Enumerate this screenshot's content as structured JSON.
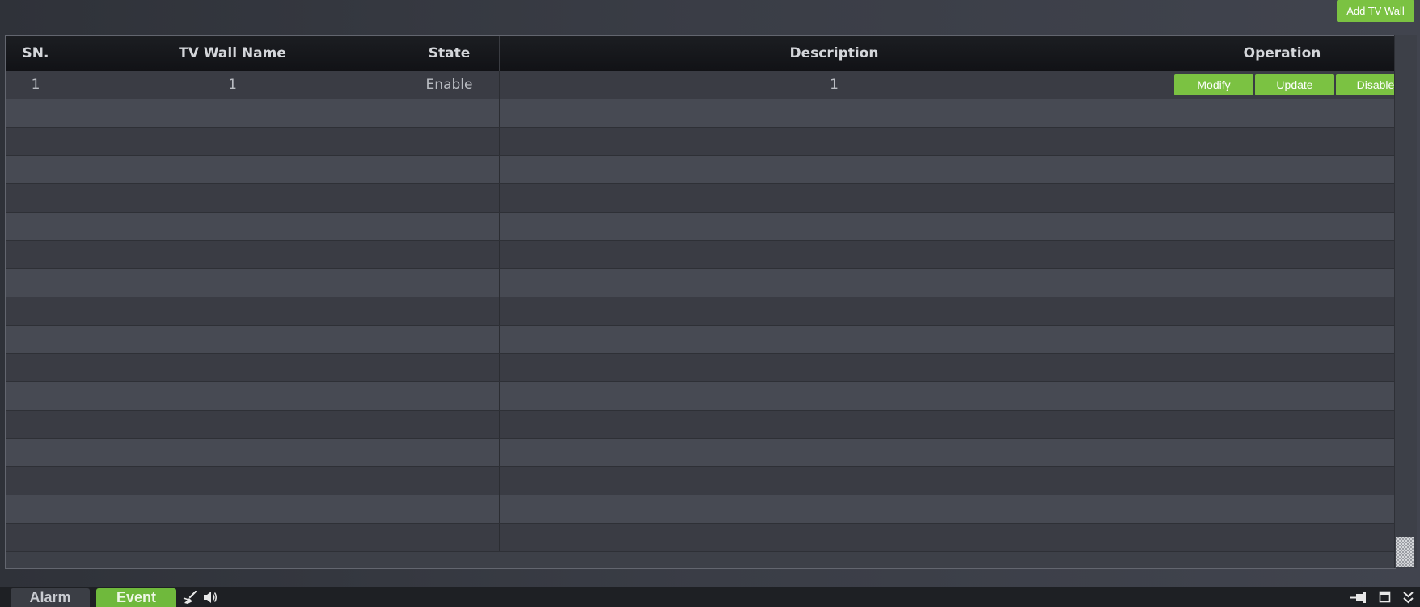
{
  "toolbar": {
    "add_label": "Add TV Wall"
  },
  "table": {
    "columns": [
      "SN.",
      "TV Wall Name",
      "State",
      "Description",
      "Operation"
    ],
    "rows": [
      {
        "sn": "1",
        "name": "1",
        "state": "Enable",
        "description": "1",
        "actions": [
          "Modify",
          "Update",
          "Disable"
        ]
      }
    ]
  },
  "bottom_bar": {
    "tabs": [
      "Alarm",
      "Event"
    ],
    "active_tab": "Event",
    "icons": [
      "broom-icon",
      "speaker-icon",
      "pin-icon",
      "maximize-icon",
      "collapse-icon"
    ]
  },
  "colors": {
    "accent": "#7bc242",
    "active_tab": "#6fb93c",
    "header_bg": "#15171b",
    "row_dark": "#3a3c44",
    "row_light": "#474a53"
  }
}
